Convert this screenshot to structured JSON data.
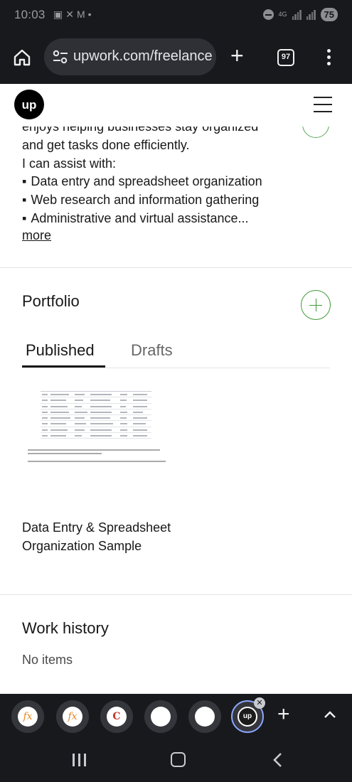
{
  "status_bar": {
    "time": "10:03",
    "left_icons": [
      "screenshot-icon",
      "tools-icon",
      "gmail-icon",
      "dot-icon"
    ],
    "network": "4G",
    "battery": "75"
  },
  "browser": {
    "url": "upwork.com/freelance",
    "tab_count": "97"
  },
  "site": {
    "logo_text": "up"
  },
  "about": {
    "lines": [
      "enjoys helping businesses stay organized",
      "and get tasks done efficiently.",
      "I can assist with:"
    ],
    "bullets": [
      "Data entry and spreadsheet organization",
      "Web research and information gathering",
      "Administrative and virtual assistance..."
    ],
    "more": "more"
  },
  "portfolio": {
    "title": "Portfolio",
    "tabs": [
      "Published",
      "Drafts"
    ],
    "active_tab": "Published",
    "items": [
      {
        "title": "Data Entry & Spreadsheet Organization Sample"
      }
    ]
  },
  "work_history": {
    "title": "Work history",
    "empty_text": "No items"
  },
  "dock": {
    "bubbles": [
      "fx",
      "fx",
      "C",
      "",
      "",
      "up"
    ],
    "active_index": 5
  },
  "colors": {
    "accent_green": "#3f9a3a",
    "dark_bar": "#18191c"
  }
}
